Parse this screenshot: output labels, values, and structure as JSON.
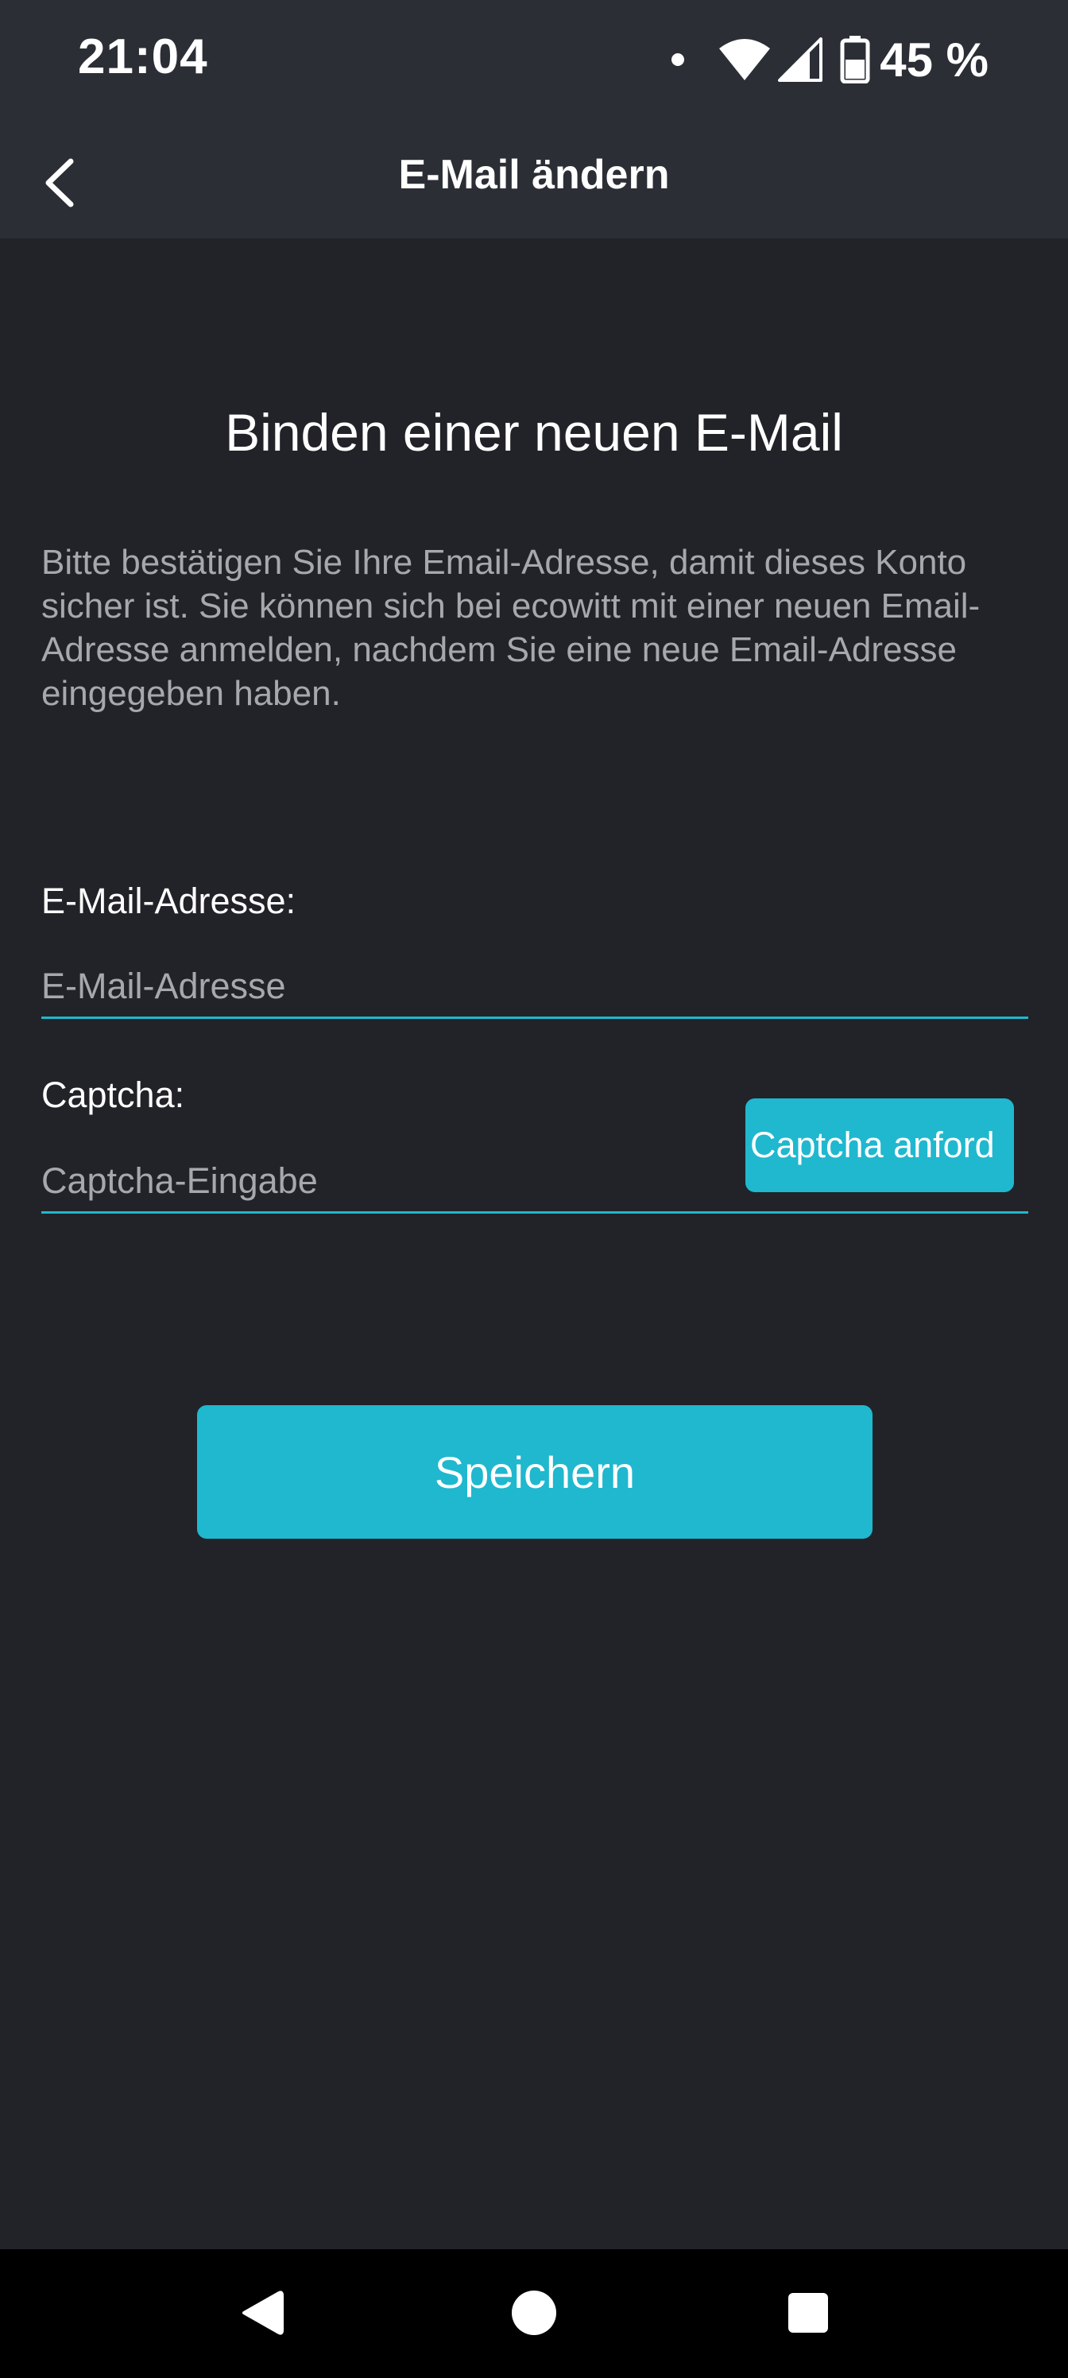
{
  "status_bar": {
    "time": "21:04",
    "battery_percent": "45 %",
    "icons": [
      "notification-dot-icon",
      "wifi-icon",
      "cellular-signal-icon",
      "battery-icon"
    ]
  },
  "app_bar": {
    "title": "E-Mail ändern",
    "back_icon": "chevron-left-icon"
  },
  "main": {
    "heading": "Binden einer neuen E-Mail",
    "description": "Bitte bestätigen Sie Ihre Email-Adresse, damit dieses Konto sicher ist. Sie können sich bei ecowitt mit einer neuen Email-Adresse anmelden, nachdem Sie eine neue Email-Adresse eingegeben haben.",
    "email": {
      "label": "E-Mail-Adresse:",
      "placeholder": "E-Mail-Adresse",
      "value": ""
    },
    "captcha": {
      "label": "Captcha:",
      "placeholder": "Captcha-Eingabe",
      "value": "",
      "request_button_label": "Captcha anford"
    },
    "save_button_label": "Speichern"
  },
  "nav_bar": {
    "icons": [
      "back-triangle-icon",
      "home-circle-icon",
      "recents-square-icon"
    ]
  },
  "colors": {
    "background": "#212328",
    "app_bar": "#2b2e35",
    "accent": "#1fb8cf",
    "text_primary": "#ffffff",
    "text_secondary": "#a6a8ad",
    "nav_bar": "#000000"
  }
}
